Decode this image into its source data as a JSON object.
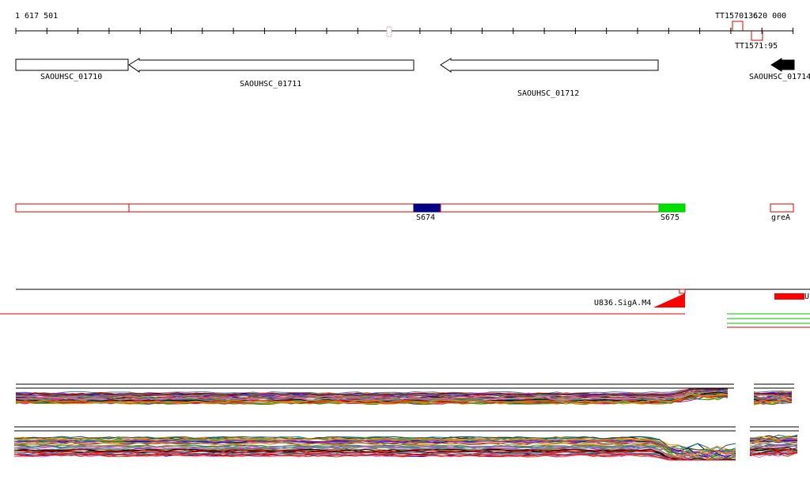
{
  "ruler": {
    "start_label": "1 617 501",
    "end_label": "1 620 000",
    "terminators": [
      {
        "label": "TT1570:36"
      },
      {
        "label": "TT1571:95"
      }
    ]
  },
  "genes": [
    {
      "label": "SAOUHSC_01710",
      "strand": "+"
    },
    {
      "label": "SAOUHSC_01711",
      "strand": "-"
    },
    {
      "label": "SAOUHSC_01712",
      "strand": "-"
    },
    {
      "label": "SAOUHSC_01714",
      "strand": "-"
    }
  ],
  "segments": [
    {
      "label": "S674",
      "color": "#000080"
    },
    {
      "label": "S675",
      "color": "#00e000"
    },
    {
      "label": "greA",
      "color": "#ffffff"
    }
  ],
  "binding_sites": [
    {
      "label": "U836.SigA.M4"
    },
    {
      "label": "U"
    }
  ],
  "colors": {
    "feature_outline": "#e00000",
    "gene_outline": "#000000",
    "gene_fill": "#ffffff",
    "signal": "#ff0000",
    "green_track": "#00c000"
  },
  "profile_colors": [
    "#000000",
    "#8b0000",
    "#ff0000",
    "#ff8c00",
    "#808000",
    "#00a000",
    "#008080",
    "#0000cd",
    "#8a2be2",
    "#c71585",
    "#a0522d",
    "#2f4f4f",
    "#6b8e23",
    "#4682b4",
    "#ff69b4",
    "#9370db",
    "#cd853f",
    "#3cb371"
  ]
}
